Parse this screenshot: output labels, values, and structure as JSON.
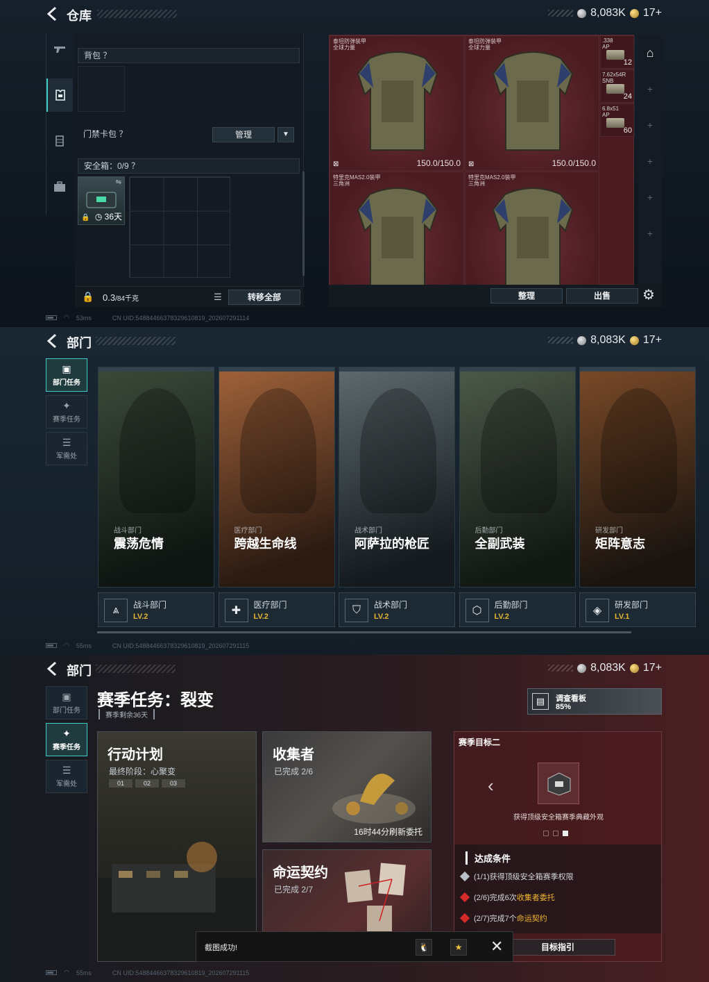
{
  "currency": {
    "silver": "8,083K",
    "gold": "17+"
  },
  "footer": {
    "ping1": "53ms",
    "ping2": "55ms",
    "ping3": "55ms",
    "uid1": "CN UID:5488446637832961081​9_202607291114",
    "uid2": "CN UID:5488446637832961081​9_202607291115",
    "uid3": "CN UID:5488446637832961081​9_202607291115"
  },
  "warehouse": {
    "title": "仓库",
    "backpack_label": "背包 ？",
    "keycard_label": "门禁卡包 ？",
    "manage_label": "管理",
    "safebox_label": "安全箱：0/9 ？",
    "safebox_days": "36天",
    "weight_value": "0.3",
    "weight_unit": "/84千克",
    "transfer_label": "转移全部",
    "sort_label": "整理",
    "sell_label": "出售",
    "armors": [
      {
        "name1": "泰坦防弹装甲",
        "name2": "全球力量",
        "durability": "150.0/150.0"
      },
      {
        "name1": "泰坦防弹装甲",
        "name2": "全球力量",
        "durability": "150.0/150.0"
      },
      {
        "name1": "特里克MAS2.0装甲",
        "name2": "三角洲",
        "durability": ""
      },
      {
        "name1": "特里克MAS2.0装甲",
        "name2": "三角洲",
        "durability": ""
      }
    ],
    "ammo": [
      {
        "name1": ".338",
        "name2": "AP",
        "count": "12"
      },
      {
        "name1": "7.62x54R",
        "name2": "SNB",
        "count": "24"
      },
      {
        "name1": "6.8x51",
        "name2": "AP",
        "count": "60"
      }
    ],
    "rail_icons": [
      "gun-icon",
      "armor-icon",
      "vest-icon",
      "briefcase-icon"
    ]
  },
  "departments": {
    "title": "部门",
    "nav": [
      {
        "label": "部门任务",
        "icon": "task-icon"
      },
      {
        "label": "赛季任务",
        "icon": "season-icon"
      },
      {
        "label": "军需处",
        "icon": "supply-icon"
      }
    ],
    "cards": [
      {
        "sub": "战斗部门",
        "name": "震荡危情",
        "dept": "战斗部门",
        "level": "LV.2",
        "c1": "#3b4a3a",
        "c2": "#0f1512"
      },
      {
        "sub": "医疗部门",
        "name": "跨越生命线",
        "dept": "医疗部门",
        "level": "LV.2",
        "c1": "#a0623a",
        "c2": "#2a1a12"
      },
      {
        "sub": "战术部门",
        "name": "阿萨拉的枪匠",
        "dept": "战术部门",
        "level": "LV.2",
        "c1": "#5e6a6e",
        "c2": "#141a1d"
      },
      {
        "sub": "后勤部门",
        "name": "全副武装",
        "dept": "后勤部门",
        "level": "LV.2",
        "c1": "#4d5a4a",
        "c2": "#121814"
      },
      {
        "sub": "研发部门",
        "name": "矩阵意志",
        "dept": "研发部门",
        "level": "LV.1",
        "c1": "#7a4a28",
        "c2": "#1a1410"
      }
    ]
  },
  "season": {
    "title": "部门",
    "task_title": "赛季任务：裂变",
    "remaining": "赛季剩余36天",
    "board_title": "调查看板",
    "board_progress": "85%",
    "tasks": {
      "plan_name": "行动计划",
      "plan_stage": "最终阶段：心聚变",
      "phases": [
        "01",
        "02",
        "03"
      ],
      "collector_name": "收集者",
      "collector_progress": "已完成 2/6",
      "collector_refresh": "16时44分刷新委托",
      "fate_name": "命运契约",
      "fate_progress": "已完成 2/7"
    },
    "goal": {
      "title": "赛季目标二",
      "reward_desc": "获得顶级安全箱赛季典藏外观",
      "conditions_title": "达成条件",
      "conditions": [
        {
          "prefix": "(1/1)获得顶级安全箱赛季权限",
          "highlight": "",
          "color": "#b9c0c6"
        },
        {
          "prefix": "(2/6)完成6次",
          "highlight": "收集者委托",
          "color": "#d42a2a"
        },
        {
          "prefix": "(2/7)完成7个",
          "highlight": "命运契约",
          "color": "#d42a2a"
        }
      ],
      "guide_label": "目标指引"
    },
    "toast": "截图成功!"
  }
}
